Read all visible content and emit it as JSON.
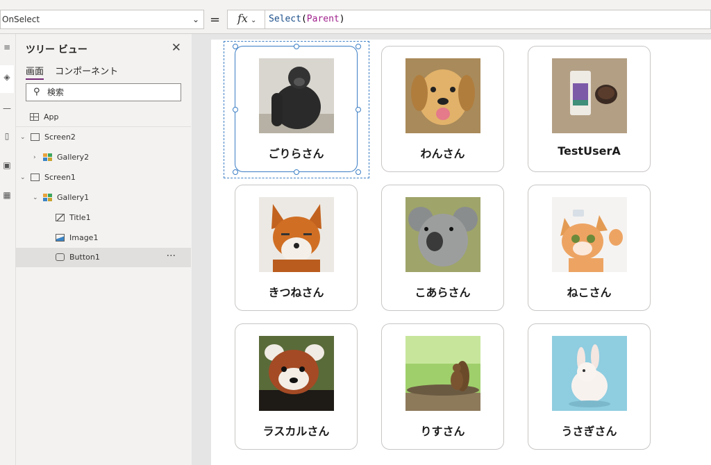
{
  "formula_bar": {
    "property": "OnSelect",
    "fx_label": "fx",
    "formula_function": "Select",
    "formula_argument": "Parent"
  },
  "tree_view": {
    "title": "ツリー ビュー",
    "tabs": [
      {
        "label": "画面",
        "active": true
      },
      {
        "label": "コンポーネント",
        "active": false
      }
    ],
    "search_placeholder": "検索",
    "nodes": [
      {
        "label": "App",
        "icon": "app-icon"
      },
      {
        "label": "Screen2",
        "icon": "screen-icon",
        "expanded": true
      },
      {
        "label": "Gallery2",
        "icon": "gallery-icon",
        "expanded": false
      },
      {
        "label": "Screen1",
        "icon": "screen-icon",
        "expanded": true
      },
      {
        "label": "Gallery1",
        "icon": "gallery-icon",
        "expanded": true
      },
      {
        "label": "Title1",
        "icon": "edit-icon"
      },
      {
        "label": "Image1",
        "icon": "image-icon"
      },
      {
        "label": "Button1",
        "icon": "button-icon",
        "selected": true
      }
    ],
    "more": "···"
  },
  "gallery": {
    "items": [
      {
        "name": "ごりらさん",
        "image": "gorilla",
        "selected": true
      },
      {
        "name": "わんさん",
        "image": "puppy"
      },
      {
        "name": "TestUserA",
        "image": "coffee-product"
      },
      {
        "name": "きつねさん",
        "image": "fox"
      },
      {
        "name": "こあらさん",
        "image": "koala"
      },
      {
        "name": "ねこさん",
        "image": "kitten"
      },
      {
        "name": "ラスカルさん",
        "image": "red-panda"
      },
      {
        "name": "りすさん",
        "image": "squirrel"
      },
      {
        "name": "うさぎさん",
        "image": "rabbit"
      }
    ]
  },
  "colors": {
    "accent": "#742774",
    "selection": "#3b7dc4"
  }
}
